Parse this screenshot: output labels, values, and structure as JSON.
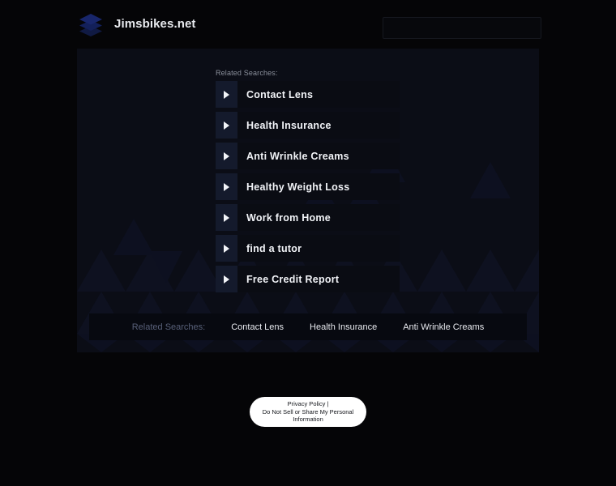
{
  "header": {
    "brand_name": "Jimsbikes.net",
    "logo_icon": "stacked-layers-icon",
    "logo_color": "#16255e",
    "search_placeholder": "",
    "search_value": ""
  },
  "main": {
    "related_searches_label": "Related Searches:",
    "items": [
      {
        "label": "Contact Lens",
        "arrow_icon": "play-triangle-icon"
      },
      {
        "label": "Health Insurance",
        "arrow_icon": "play-triangle-icon"
      },
      {
        "label": "Anti Wrinkle Creams",
        "arrow_icon": "play-triangle-icon"
      },
      {
        "label": "Healthy Weight Loss",
        "arrow_icon": "play-triangle-icon"
      },
      {
        "label": "Work from Home",
        "arrow_icon": "play-triangle-icon"
      },
      {
        "label": "find a tutor",
        "arrow_icon": "play-triangle-icon"
      },
      {
        "label": "Free Credit Report",
        "arrow_icon": "play-triangle-icon"
      }
    ]
  },
  "bottom_bar": {
    "label": "Related Searches:",
    "links": [
      "Contact Lens",
      "Health Insurance",
      "Anti Wrinkle Creams"
    ]
  },
  "footer": {
    "privacy_line1": "Privacy Policy |",
    "privacy_line2": "Do Not Sell or Share My Personal",
    "privacy_line3": "Information"
  },
  "colors": {
    "page_background": "#050507",
    "card_background": "#0b0d16",
    "row_background": "#0a0c13",
    "row_arrow_background": "#141a2c",
    "text_primary": "#f1f3f7",
    "text_muted": "#8b909c",
    "bar_label": "#586079",
    "pill_background": "#ffffff"
  }
}
